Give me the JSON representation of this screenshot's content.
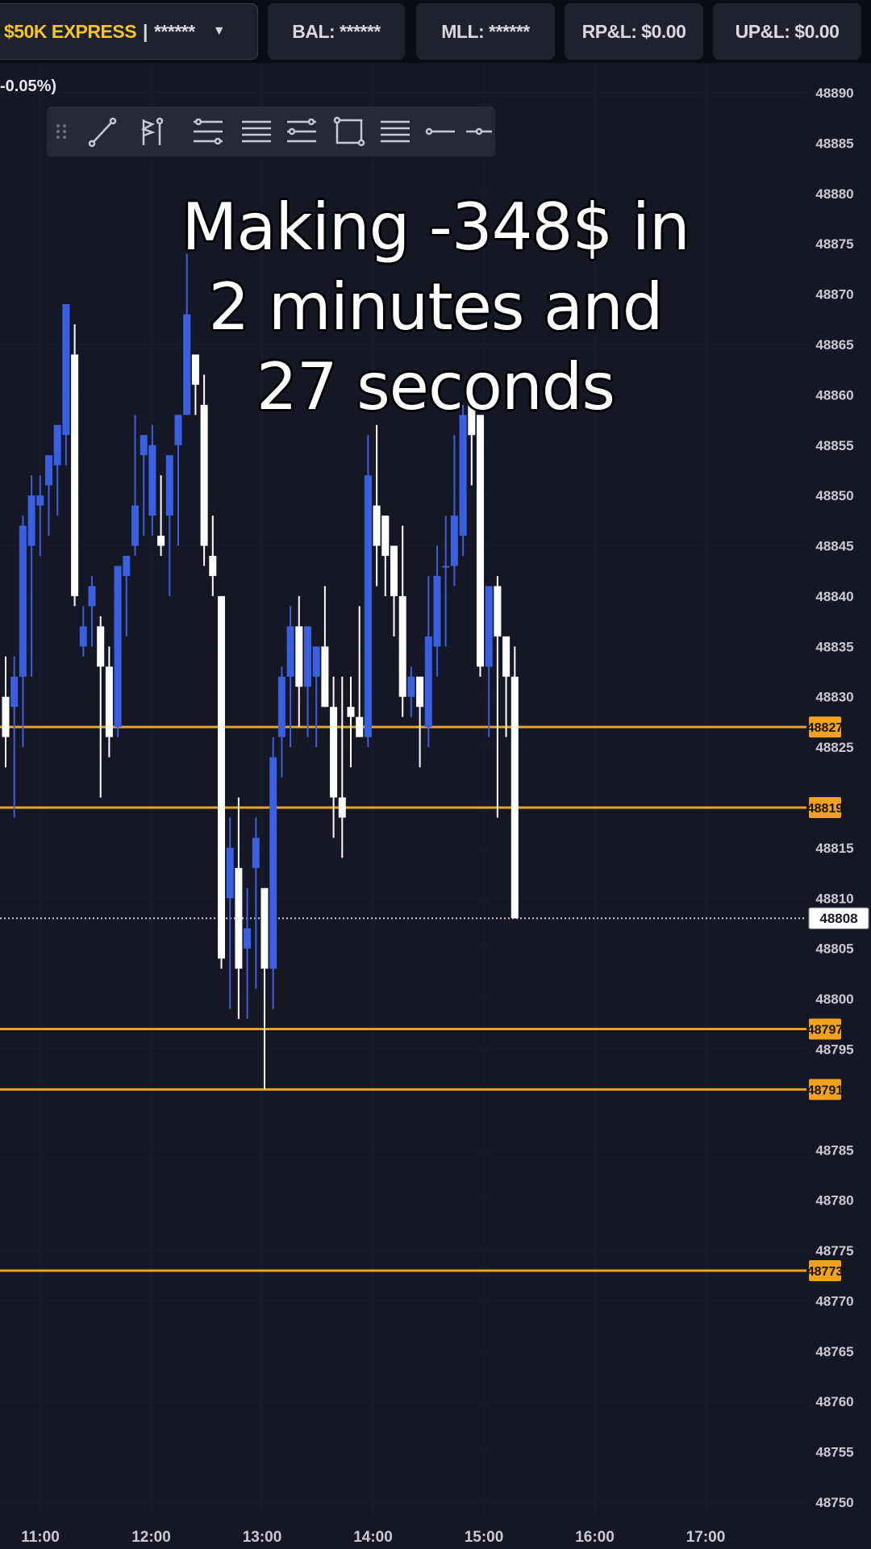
{
  "topbar": {
    "account_name": "$50K EXPRESS",
    "account_separator": "|",
    "account_masked": "******",
    "account_caret": "▼",
    "balance": "BAL: ******",
    "mll": "MLL: ******",
    "rpnl": "RP&L: $0.00",
    "upnl": "UP&L: $0.00"
  },
  "price_change_label": "-0.05%)",
  "toolbar": {
    "tools": [
      "grip-icon",
      "trend-line-icon",
      "flag-icon",
      "parallel-channel-icon",
      "fib-retracement-icon",
      "fib-extension-icon",
      "rectangle-icon",
      "horizontal-lines-icon",
      "horizontal-line-icon",
      "horizontal-ray-icon"
    ]
  },
  "overlay": {
    "line1": "Making -348$ in",
    "line2": "2 minutes and",
    "line3": "27 seconds"
  },
  "colors": {
    "background": "#151824",
    "bull": "#3a5fe0",
    "bear": "#ffffff",
    "level": "#f0a11e",
    "axis_text": "#c9cbd1"
  },
  "chart_data": {
    "type": "candlestick",
    "ylim": [
      48747,
      48892
    ],
    "y_ticks": [
      48890,
      48885,
      48880,
      48875,
      48870,
      48865,
      48860,
      48855,
      48850,
      48845,
      48840,
      48835,
      48830,
      48825,
      48815,
      48810,
      48805,
      48800,
      48795,
      48785,
      48780,
      48775,
      48770,
      48765,
      48760,
      48755,
      48750
    ],
    "x_ticks": [
      "11:00",
      "12:00",
      "13:00",
      "14:00",
      "15:00",
      "16:00",
      "17:00"
    ],
    "level_lines": [
      48827,
      48819,
      48797,
      48791,
      48773
    ],
    "current_price": 48808,
    "candles": [
      {
        "o": 48830,
        "h": 48834,
        "l": 48823,
        "c": 48826
      },
      {
        "o": 48829,
        "h": 48834,
        "l": 48818,
        "c": 48832
      },
      {
        "o": 48832,
        "h": 48848,
        "l": 48825,
        "c": 48847
      },
      {
        "o": 48845,
        "h": 48852,
        "l": 48832,
        "c": 48850
      },
      {
        "o": 48849,
        "h": 48852,
        "l": 48844,
        "c": 48850
      },
      {
        "o": 48851,
        "h": 48854,
        "l": 48846,
        "c": 48854
      },
      {
        "o": 48853,
        "h": 48856,
        "l": 48848,
        "c": 48857
      },
      {
        "o": 48856,
        "h": 48869,
        "l": 48853,
        "c": 48869
      },
      {
        "o": 48864,
        "h": 48867,
        "l": 48839,
        "c": 48840
      },
      {
        "o": 48835,
        "h": 48839,
        "l": 48834,
        "c": 48837
      },
      {
        "o": 48839,
        "h": 48842,
        "l": 48835,
        "c": 48841
      },
      {
        "o": 48837,
        "h": 48838,
        "l": 48820,
        "c": 48833
      },
      {
        "o": 48833,
        "h": 48835,
        "l": 48824,
        "c": 48826
      },
      {
        "o": 48827,
        "h": 48841,
        "l": 48826,
        "c": 48843
      },
      {
        "o": 48842,
        "h": 48843,
        "l": 48836,
        "c": 48844
      },
      {
        "o": 48845,
        "h": 48858,
        "l": 48844,
        "c": 48849
      },
      {
        "o": 48854,
        "h": 48856,
        "l": 48846,
        "c": 48856
      },
      {
        "o": 48848,
        "h": 48857,
        "l": 48846,
        "c": 48855
      },
      {
        "o": 48846,
        "h": 48852,
        "l": 48844,
        "c": 48845
      },
      {
        "o": 48848,
        "h": 48851,
        "l": 48840,
        "c": 48854
      },
      {
        "o": 48855,
        "h": 48858,
        "l": 48845,
        "c": 48858
      },
      {
        "o": 48858,
        "h": 48874,
        "l": 48858,
        "c": 48868
      },
      {
        "o": 48864,
        "h": 48862,
        "l": 48858,
        "c": 48861
      },
      {
        "o": 48859,
        "h": 48862,
        "l": 48843,
        "c": 48845
      },
      {
        "o": 48844,
        "h": 48848,
        "l": 48840,
        "c": 48842
      },
      {
        "o": 48840,
        "h": 48840,
        "l": 48803,
        "c": 48804
      },
      {
        "o": 48810,
        "h": 48818,
        "l": 48799,
        "c": 48815
      },
      {
        "o": 48813,
        "h": 48820,
        "l": 48798,
        "c": 48803
      },
      {
        "o": 48805,
        "h": 48811,
        "l": 48798,
        "c": 48807
      },
      {
        "o": 48813,
        "h": 48818,
        "l": 48801,
        "c": 48816
      },
      {
        "o": 48811,
        "h": 48810,
        "l": 48791,
        "c": 48803
      },
      {
        "o": 48803,
        "h": 48826,
        "l": 48799,
        "c": 48824
      },
      {
        "o": 48826,
        "h": 48833,
        "l": 48822,
        "c": 48832
      },
      {
        "o": 48832,
        "h": 48839,
        "l": 48825,
        "c": 48837
      },
      {
        "o": 48837,
        "h": 48840,
        "l": 48827,
        "c": 48831
      },
      {
        "o": 48831,
        "h": 48837,
        "l": 48826,
        "c": 48837
      },
      {
        "o": 48832,
        "h": 48834,
        "l": 48825,
        "c": 48835
      },
      {
        "o": 48835,
        "h": 48841,
        "l": 48829,
        "c": 48829
      },
      {
        "o": 48829,
        "h": 48832,
        "l": 48816,
        "c": 48820
      },
      {
        "o": 48820,
        "h": 48832,
        "l": 48814,
        "c": 48818
      },
      {
        "o": 48829,
        "h": 48832,
        "l": 48823,
        "c": 48828
      },
      {
        "o": 48828,
        "h": 48839,
        "l": 48827,
        "c": 48826
      },
      {
        "o": 48826,
        "h": 48856,
        "l": 48825,
        "c": 48852
      },
      {
        "o": 48849,
        "h": 48857,
        "l": 48841,
        "c": 48845
      },
      {
        "o": 48848,
        "h": 48848,
        "l": 48840,
        "c": 48844
      },
      {
        "o": 48845,
        "h": 48845,
        "l": 48836,
        "c": 48840
      },
      {
        "o": 48840,
        "h": 48847,
        "l": 48828,
        "c": 48830
      },
      {
        "o": 48830,
        "h": 48833,
        "l": 48828,
        "c": 48832
      },
      {
        "o": 48832,
        "h": 48832,
        "l": 48823,
        "c": 48829
      },
      {
        "o": 48827,
        "h": 48842,
        "l": 48825,
        "c": 48836
      },
      {
        "o": 48835,
        "h": 48845,
        "l": 48832,
        "c": 48842
      },
      {
        "o": 48843,
        "h": 48848,
        "l": 48835,
        "c": 48843
      },
      {
        "o": 48843,
        "h": 48856,
        "l": 48841,
        "c": 48848
      },
      {
        "o": 48846,
        "h": 48859,
        "l": 48844,
        "c": 48858
      },
      {
        "o": 48859,
        "h": 48862,
        "l": 48851,
        "c": 48856
      },
      {
        "o": 48858,
        "h": 48850,
        "l": 48832,
        "c": 48833
      },
      {
        "o": 48833,
        "h": 48838,
        "l": 48826,
        "c": 48841
      },
      {
        "o": 48841,
        "h": 48842,
        "l": 48818,
        "c": 48836
      },
      {
        "o": 48836,
        "h": 48836,
        "l": 48826,
        "c": 48832
      },
      {
        "o": 48832,
        "h": 48835,
        "l": 48808,
        "c": 48808
      }
    ]
  }
}
